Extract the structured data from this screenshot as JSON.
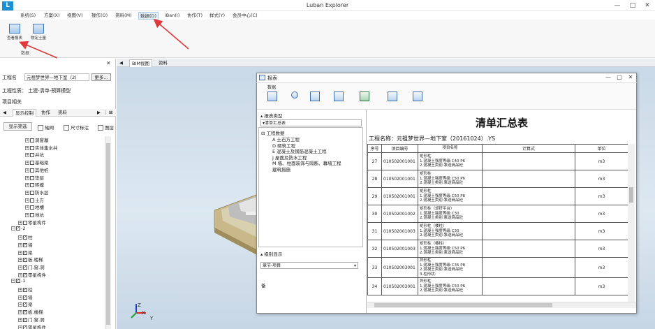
{
  "app": {
    "title": "Luban Explorer",
    "logo_glyph": "L"
  },
  "window_controls": {
    "minimize": "—",
    "maximize": "□",
    "close": "✕"
  },
  "menu": [
    "系统(S)",
    "方案(X)",
    "视图(V)",
    "操作(O)",
    "资料(M)",
    "数据(D)",
    "iBan(I)",
    "协作(T)",
    "样式(Y)",
    "会员中心(C)"
  ],
  "ribbon": {
    "buttons": [
      "查看报表",
      "物定土量"
    ],
    "group_label": "数据",
    "icons": [
      "table-report-icon",
      "table-quantity-icon"
    ]
  },
  "left_panel": {
    "close_glyph": "✕",
    "project_label": "工程名",
    "project_value": "元祖梦世界—地下室（2(",
    "more_button": "更多...",
    "property_label": "工程性质：  土建-清单-预算模型",
    "related_label": "项目相关",
    "tabs": [
      "显示控制",
      "协作",
      "资料"
    ],
    "tab_nav": [
      "◀",
      "▶",
      "⋮",
      "⊠"
    ],
    "filter_button": "显示筛选",
    "checkboxes": [
      "轴网",
      "尺寸标注",
      "图层"
    ],
    "tree": [
      {
        "indent": 1,
        "exp": "+",
        "chk": "",
        "text": "洞窗墓"
      },
      {
        "indent": 1,
        "exp": "+",
        "chk": "",
        "text": "实体集水井"
      },
      {
        "indent": 1,
        "exp": "+",
        "chk": "",
        "text": "井坑"
      },
      {
        "indent": 1,
        "exp": "+",
        "chk": "",
        "text": "基础梁"
      },
      {
        "indent": 1,
        "exp": "+",
        "chk": "",
        "text": "其他桩"
      },
      {
        "indent": 1,
        "exp": "+",
        "chk": "",
        "text": "垫层"
      },
      {
        "indent": 1,
        "exp": "+",
        "chk": "",
        "text": "砖模"
      },
      {
        "indent": 1,
        "exp": "+",
        "chk": "",
        "text": "防水层"
      },
      {
        "indent": 1,
        "exp": "+",
        "chk": "",
        "text": "土方"
      },
      {
        "indent": 1,
        "exp": "+",
        "chk": "",
        "text": "地槽"
      },
      {
        "indent": 1,
        "exp": "+",
        "chk": "",
        "text": "地坑"
      },
      {
        "indent": 0,
        "exp": "+",
        "chk": "",
        "text": "零星构件"
      },
      {
        "indent": -1,
        "exp": "−",
        "chk": "✓",
        "text": "-2"
      },
      {
        "indent": 0,
        "exp": "+",
        "chk": "✓",
        "text": "柱"
      },
      {
        "indent": 0,
        "exp": "+",
        "chk": "✓",
        "text": "墙"
      },
      {
        "indent": 0,
        "exp": "+",
        "chk": "✓",
        "text": "梁"
      },
      {
        "indent": 0,
        "exp": "+",
        "chk": "✓",
        "text": "板.楼梯"
      },
      {
        "indent": 0,
        "exp": "+",
        "chk": "✓",
        "text": "门.窗.洞"
      },
      {
        "indent": 0,
        "exp": "+",
        "chk": "✓",
        "text": "零星构件"
      },
      {
        "indent": -1,
        "exp": "−",
        "chk": "✓",
        "text": "-1"
      },
      {
        "indent": 0,
        "exp": "+",
        "chk": "✓",
        "text": "柱"
      },
      {
        "indent": 0,
        "exp": "+",
        "chk": "✓",
        "text": "墙"
      },
      {
        "indent": 0,
        "exp": "+",
        "chk": "✓",
        "text": "梁"
      },
      {
        "indent": 0,
        "exp": "+",
        "chk": "✓",
        "text": "板.楼梯"
      },
      {
        "indent": 0,
        "exp": "+",
        "chk": "✓",
        "text": "门.窗.洞"
      },
      {
        "indent": 0,
        "exp": "+",
        "chk": "✓",
        "text": "零星构件"
      }
    ]
  },
  "doc_tabs": {
    "nav": "◀",
    "tabs": [
      "BIM视图",
      "资料"
    ]
  },
  "viewport": {
    "axis_x": "X",
    "axis_y": "Y",
    "axis_z": "Z"
  },
  "report": {
    "title": "报表",
    "toolbar_group": "数据",
    "toolbar_icons": [
      "bar-chart-icon",
      "search-icon",
      "document-list-icon",
      "printer-icon",
      "excel-icon",
      "pdf-icon",
      "settings-report-icon"
    ],
    "section_report_type": "报表类型",
    "report_type_value": "清单汇总表",
    "project_tree": {
      "root": "工程数据",
      "items": [
        "A 土石方工程",
        "D 砌筑工程",
        "E 混凝土及钢筋混凝土工程",
        "J 屋面及防水工程",
        "M 墙、柱面装饰与隔断、幕墙工程",
        "建筑措施"
      ]
    },
    "section_level": "级别显示",
    "level_value": "章节-项目",
    "bottom_glyph": "备",
    "heading": "清单汇总表",
    "project_line": "工程名称：元祖梦世界—地下室（20161024）.YS",
    "columns": [
      "序号",
      "项目编号",
      "项目名称",
      "计算式",
      "单位"
    ],
    "rows": [
      {
        "idx": "27",
        "code": "010502001001",
        "name": [
          "矩形柱",
          "1.混凝土强度等级:C40 P6",
          "2.混凝土类别:泵送商品砼"
        ],
        "formula": "",
        "unit": "m3"
      },
      {
        "idx": "28",
        "code": "010502001001",
        "name": [
          "矩形柱",
          "1.混凝土强度等级:C50 P6",
          "2.混凝土类别:泵送商品砼"
        ],
        "formula": "",
        "unit": "m3"
      },
      {
        "idx": "29",
        "code": "010502001001",
        "name": [
          "矩形柱",
          "1.混凝土强度等级:C50 P8",
          "2.混凝土类别:泵送商品砼"
        ],
        "formula": "",
        "unit": "m3"
      },
      {
        "idx": "30",
        "code": "010502001002",
        "name": [
          "矩形柱（却挤平台）",
          "1.混凝土强度等级:C30",
          "2.混凝土类别:泵送商品砼"
        ],
        "formula": "",
        "unit": "m3"
      },
      {
        "idx": "31",
        "code": "010502001003",
        "name": [
          "矩形柱（楼柱）",
          "1.混凝土强度等级:C30",
          "2.混凝土类别:泵送商品砼"
        ],
        "formula": "",
        "unit": "m3"
      },
      {
        "idx": "32",
        "code": "010502001003",
        "name": [
          "矩形柱（楼柱）",
          "1.混凝土强度等级:C50 P6",
          "2.混凝土类别:泵送商品砼"
        ],
        "formula": "",
        "unit": "m3"
      },
      {
        "idx": "33",
        "code": "010502003001",
        "name": [
          "异形柱",
          "1.混凝土强度等级:C35 P8",
          "2.混凝土类别:泵送商品砼",
          "3.柱形状:"
        ],
        "formula": "",
        "unit": "m3"
      },
      {
        "idx": "34",
        "code": "010502003001",
        "name": [
          "异形柱",
          "1.混凝土强度等级:C50 P6",
          "2.混凝土类别:泵送商品砼"
        ],
        "formula": "",
        "unit": "m3"
      }
    ]
  },
  "colors": {
    "accent": "#1d8fd2",
    "arrow": "#e03a3a",
    "viewport": "#d3e1ec"
  }
}
